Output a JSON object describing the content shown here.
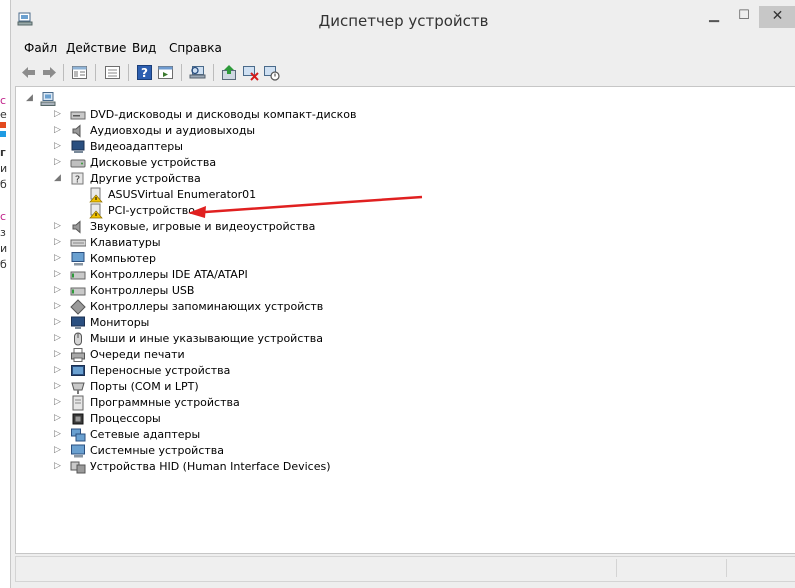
{
  "window": {
    "title": "Диспетчер устройств"
  },
  "menu": [
    "Файл",
    "Действие",
    "Вид",
    "Справка"
  ],
  "toolbar_icons": [
    "back-arrow-icon",
    "forward-arrow-icon",
    "properties-icon",
    "show-hidden-icon",
    "help-icon",
    "action-icon",
    "scan-hardware-icon",
    "update-driver-icon",
    "uninstall-icon",
    "disable-device-icon"
  ],
  "tree": {
    "root_label": "",
    "categories": [
      {
        "label": "DVD-дисководы и дисководы компакт-дисков",
        "icon": "dvd-drive-icon",
        "expanded": false
      },
      {
        "label": "Аудиовходы и аудиовыходы",
        "icon": "speaker-icon",
        "expanded": false
      },
      {
        "label": "Видеоадаптеры",
        "icon": "display-adapter-icon",
        "expanded": false
      },
      {
        "label": "Дисковые устройства",
        "icon": "disk-drive-icon",
        "expanded": false
      },
      {
        "label": "Другие устройства",
        "icon": "other-devices-icon",
        "expanded": true,
        "children": [
          {
            "label": "ASUSVirtual Enumerator01",
            "icon": "warning-device-icon"
          },
          {
            "label": "PCI-устройство",
            "icon": "warning-device-icon"
          }
        ]
      },
      {
        "label": "Звуковые, игровые и видеоустройства",
        "icon": "sound-icon",
        "expanded": false
      },
      {
        "label": "Клавиатуры",
        "icon": "keyboard-icon",
        "expanded": false
      },
      {
        "label": "Компьютер",
        "icon": "computer-icon",
        "expanded": false
      },
      {
        "label": "Контроллеры IDE ATA/ATAPI",
        "icon": "ide-controller-icon",
        "expanded": false
      },
      {
        "label": "Контроллеры USB",
        "icon": "usb-controller-icon",
        "expanded": false
      },
      {
        "label": "Контроллеры запоминающих устройств",
        "icon": "storage-controller-icon",
        "expanded": false
      },
      {
        "label": "Мониторы",
        "icon": "monitor-icon",
        "expanded": false
      },
      {
        "label": "Мыши и иные указывающие устройства",
        "icon": "mouse-icon",
        "expanded": false
      },
      {
        "label": "Очереди печати",
        "icon": "printer-icon",
        "expanded": false
      },
      {
        "label": "Переносные устройства",
        "icon": "portable-device-icon",
        "expanded": false
      },
      {
        "label": "Порты (COM и LPT)",
        "icon": "port-icon",
        "expanded": false
      },
      {
        "label": "Программные устройства",
        "icon": "software-device-icon",
        "expanded": false
      },
      {
        "label": "Процессоры",
        "icon": "processor-icon",
        "expanded": false
      },
      {
        "label": "Сетевые адаптеры",
        "icon": "network-adapter-icon",
        "expanded": false
      },
      {
        "label": "Системные устройства",
        "icon": "system-device-icon",
        "expanded": false
      },
      {
        "label": "Устройства HID (Human Interface Devices)",
        "icon": "hid-device-icon",
        "expanded": false
      }
    ]
  },
  "colors": {
    "annotation_arrow": "#e02020",
    "warning": "#f2c200"
  }
}
